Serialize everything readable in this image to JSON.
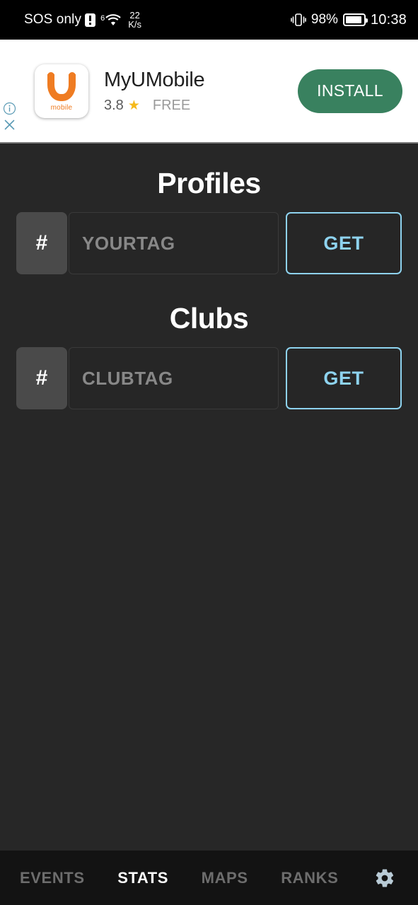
{
  "status_bar": {
    "carrier": "SOS only",
    "alert_icon": "alert-triangle-icon",
    "network_gen": "6",
    "wifi_icon": "wifi-icon",
    "net_speed_value": "22",
    "net_speed_unit": "K/s",
    "vibrate_icon": "vibrate-icon",
    "battery_percent": "98%",
    "battery_icon": "battery-icon",
    "clock": "10:38",
    "background_color": "#000000"
  },
  "ad_banner": {
    "info_icon": "info-circle-icon",
    "close_icon": "close-x-icon",
    "app_icon_caption": "mobile",
    "app_name": "MyUMobile",
    "rating": "3.8",
    "star_icon": "star-icon",
    "price_label": "FREE",
    "install_label": "INSTALL",
    "install_color": "#39815f",
    "star_color": "#f5b919",
    "logo_color": "#ef7c22"
  },
  "main": {
    "background_color": "#272727",
    "sections": [
      {
        "title": "Profiles",
        "hash_symbol": "#",
        "input_value": "",
        "input_placeholder": "YOURTAG",
        "get_label": "GET"
      },
      {
        "title": "Clubs",
        "hash_symbol": "#",
        "input_value": "",
        "input_placeholder": "CLUBTAG",
        "get_label": "GET"
      }
    ],
    "accent_color": "#8ed3ef"
  },
  "bottom_nav": {
    "background_color": "#131313",
    "items": [
      {
        "label": "EVENTS",
        "active": false
      },
      {
        "label": "STATS",
        "active": true
      },
      {
        "label": "MAPS",
        "active": false
      },
      {
        "label": "RANKS",
        "active": false
      }
    ],
    "settings_icon": "gear-icon",
    "active_color": "#ffffff",
    "inactive_color": "#6d6d6d"
  }
}
